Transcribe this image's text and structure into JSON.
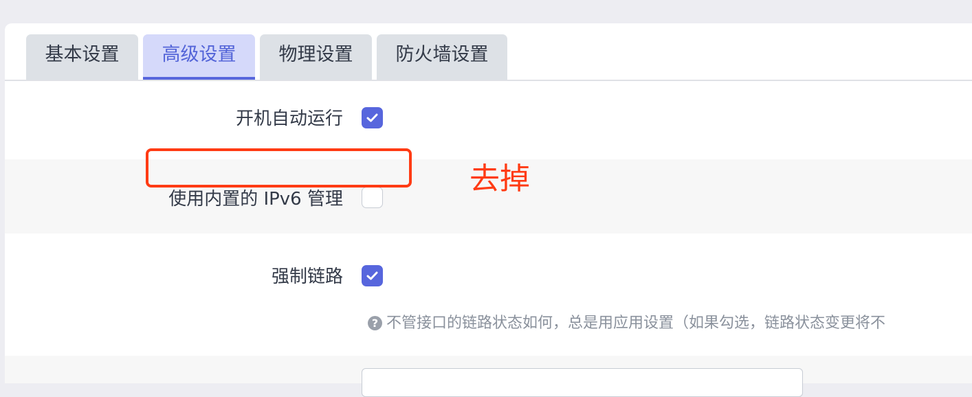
{
  "tabs": [
    {
      "label": "基本设置",
      "active": false
    },
    {
      "label": "高级设置",
      "active": true
    },
    {
      "label": "物理设置",
      "active": false
    },
    {
      "label": "防火墙设置",
      "active": false
    }
  ],
  "settings": {
    "autostart": {
      "label": "开机自动运行",
      "checked": true
    },
    "ipv6": {
      "label": "使用内置的 IPv6 管理",
      "checked": false
    },
    "force_link": {
      "label": "强制链路",
      "checked": true,
      "hint": "不管接口的链路状态如何，总是用应用设置（如果勾选，链路状态变更将不"
    }
  },
  "annotation": {
    "text": "去掉",
    "color": "#ff3b14"
  },
  "colors": {
    "accent": "#5766dd",
    "tab_active_bg": "#d5d9fa"
  }
}
